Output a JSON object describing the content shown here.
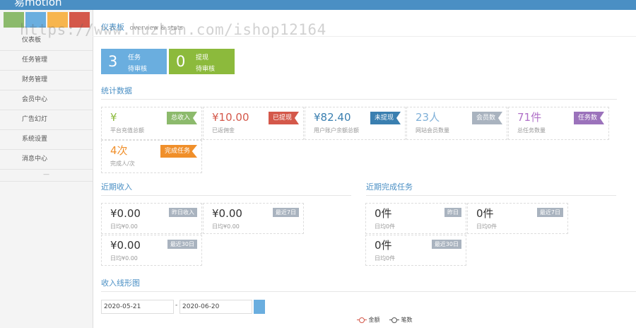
{
  "app": {
    "title": "易motion"
  },
  "header": {
    "tiles": [
      "#8cba6c",
      "#6aaedf",
      "#f7b54e",
      "#d4584a"
    ]
  },
  "sidebar": {
    "items": [
      {
        "label": "仪表板"
      },
      {
        "label": "任务管理"
      },
      {
        "label": "财务管理"
      },
      {
        "label": "会员中心"
      },
      {
        "label": "广告幻灯"
      },
      {
        "label": "系统设置"
      },
      {
        "label": "消息中心"
      }
    ],
    "collapse": "—"
  },
  "watermark": "https://www.huzhan.com/ishop12164",
  "breadcrumb": {
    "title": "仪表板",
    "subtitle": "overview & stats"
  },
  "pending": [
    {
      "count": "3",
      "line1": "任务",
      "line2": "待审核",
      "color": "#6aaedf"
    },
    {
      "count": "0",
      "line1": "提现",
      "line2": "待审核",
      "color": "#8cba3c"
    }
  ],
  "stats": {
    "title": "统计数据",
    "cards": [
      {
        "value": "¥",
        "label": "平台充值总额",
        "badge": "总收入",
        "color": "#8cba6c"
      },
      {
        "value": "¥10.00",
        "label": "已返佣金",
        "badge": "已提现",
        "color": "#d4584a"
      },
      {
        "value": "¥82.40",
        "label": "用户账户余额总额",
        "badge": "未提现",
        "color": "#3a7fb0"
      },
      {
        "value": "23人",
        "label": "网站会员数量",
        "badge": "会员数",
        "color": "#a9b3bf"
      },
      {
        "value": "71件",
        "label": "总任务数量",
        "badge": "任务数",
        "color": "#9b72bb"
      },
      {
        "value": "4次",
        "label": "完成人/次",
        "badge": "完成任务",
        "color": "#f08f2a"
      }
    ]
  },
  "income": {
    "title": "近期收入",
    "boxes": [
      {
        "value": "¥0.00",
        "sub": "日均¥0.00",
        "tag": "昨日收入"
      },
      {
        "value": "¥0.00",
        "sub": "日均¥0.00",
        "tag": "最近7日"
      },
      {
        "value": "¥0.00",
        "sub": "日均¥0.00",
        "tag": "最近30日"
      }
    ]
  },
  "tasks": {
    "title": "近期完成任务",
    "boxes": [
      {
        "value": "0件",
        "sub": "日均0件",
        "tag": "昨日"
      },
      {
        "value": "0件",
        "sub": "日均0件",
        "tag": "最近7日"
      },
      {
        "value": "0件",
        "sub": "日均0件",
        "tag": "最近30日"
      }
    ]
  },
  "chart": {
    "title": "收入线形图",
    "date_from": "2020-05-21",
    "date_sep": "-",
    "date_to": "2020-06-20",
    "legend": [
      {
        "name": "金额",
        "color": "#d4584a"
      },
      {
        "name": "笔数",
        "color": "#555555"
      }
    ]
  }
}
